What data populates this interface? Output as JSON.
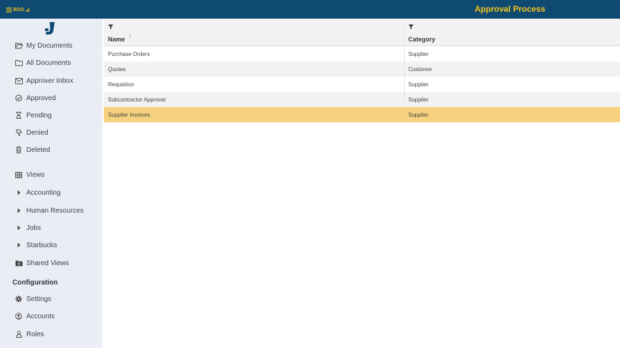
{
  "header": {
    "brand": "BOG",
    "title": "Approval Process"
  },
  "sidebar": {
    "items": [
      {
        "label": "My Documents",
        "icon": "folder-open-icon"
      },
      {
        "label": "All Documents",
        "icon": "folder-icon"
      },
      {
        "label": "Approver Inbox",
        "icon": "envelope-icon"
      },
      {
        "label": "Approved",
        "icon": "check-circle-icon"
      },
      {
        "label": "Pending",
        "icon": "hourglass-icon"
      },
      {
        "label": "Denied",
        "icon": "thumbs-down-icon"
      },
      {
        "label": "Deleted",
        "icon": "trash-icon"
      }
    ],
    "views": [
      {
        "label": "Views",
        "icon": "table-icon"
      },
      {
        "label": "Accounting",
        "icon": "caret-right-icon"
      },
      {
        "label": "Human Resources",
        "icon": "caret-right-icon"
      },
      {
        "label": "Jobs",
        "icon": "caret-right-icon"
      },
      {
        "label": "Starbucks",
        "icon": "caret-right-icon"
      },
      {
        "label": "Shared Views",
        "icon": "shared-folder-icon"
      }
    ],
    "config_heading": "Configuration",
    "config": [
      {
        "label": "Settings",
        "icon": "gear-icon"
      },
      {
        "label": "Accounts",
        "icon": "user-circle-icon"
      },
      {
        "label": "Roles",
        "icon": "user-icon"
      }
    ]
  },
  "grid": {
    "columns": [
      "Name",
      "Category"
    ],
    "sort_indicator": "↑",
    "rows": [
      {
        "name": "Purchase Orders",
        "category": "Supplier"
      },
      {
        "name": "Quotes",
        "category": "Customer"
      },
      {
        "name": "Requistion",
        "category": "Supplier"
      },
      {
        "name": "Subcontractor Approval",
        "category": "Supplier"
      },
      {
        "name": "Supplier Invoices",
        "category": "Supplier"
      }
    ],
    "selected_row": 4
  },
  "colors": {
    "topbar": "#0f4a72",
    "title": "#f5c518",
    "sidebar": "#ebedf5",
    "selected_row": "#f7d27e"
  }
}
